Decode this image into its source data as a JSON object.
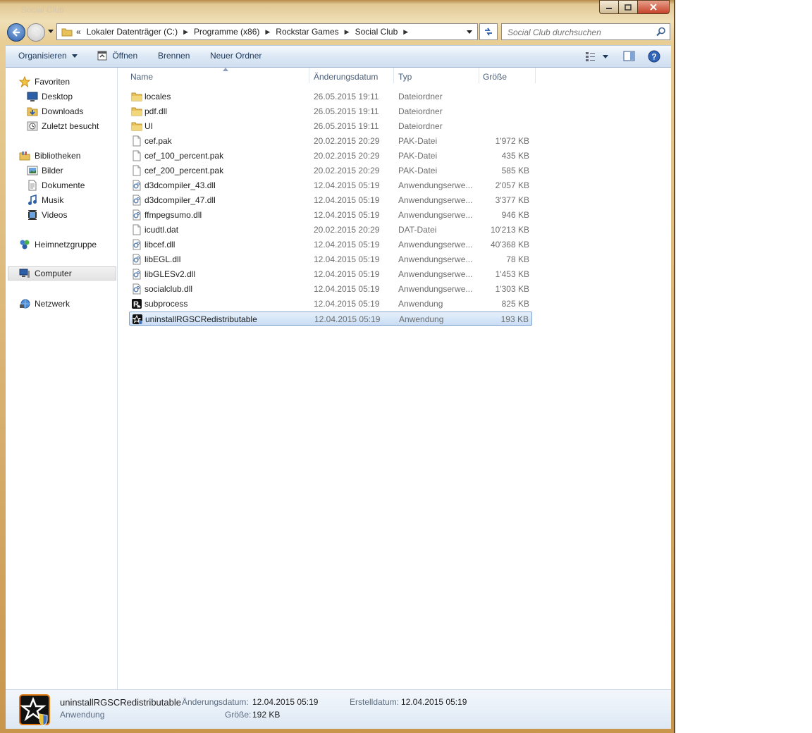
{
  "window": {
    "title": "Social Club",
    "colors": {
      "frame": "#e1c894",
      "toolbar": "#dce8f5",
      "selection": "#c8ddf5",
      "close": "#c7432b"
    }
  },
  "nav": {
    "address": {
      "overflow": "«",
      "breadcrumbs": [
        "Lokaler Datenträger (C:)",
        "Programme (x86)",
        "Rockstar Games",
        "Social Club"
      ]
    },
    "search_placeholder": "Social Club durchsuchen"
  },
  "toolbar": {
    "organize_label": "Organisieren",
    "open_label": "Öffnen",
    "burn_label": "Brennen",
    "new_folder_label": "Neuer Ordner"
  },
  "sidebar": {
    "favorites": {
      "label": "Favoriten",
      "items": [
        "Desktop",
        "Downloads",
        "Zuletzt besucht"
      ]
    },
    "libraries": {
      "label": "Bibliotheken",
      "items": [
        "Bilder",
        "Dokumente",
        "Musik",
        "Videos"
      ]
    },
    "homegroup": "Heimnetzgruppe",
    "computer": "Computer",
    "network": "Netzwerk"
  },
  "columns": {
    "name": "Name",
    "date": "Änderungsdatum",
    "type": "Typ",
    "size": "Größe"
  },
  "files": [
    {
      "name": "locales",
      "date": "26.05.2015 19:11",
      "type": "Dateiordner",
      "size": "",
      "icon": "folder-icon"
    },
    {
      "name": "pdf.dll",
      "date": "26.05.2015 19:11",
      "type": "Dateiordner",
      "size": "",
      "icon": "folder-icon"
    },
    {
      "name": "UI",
      "date": "26.05.2015 19:11",
      "type": "Dateiordner",
      "size": "",
      "icon": "folder-icon"
    },
    {
      "name": "cef.pak",
      "date": "20.02.2015 20:29",
      "type": "PAK-Datei",
      "size": "1'972 KB",
      "icon": "file-icon"
    },
    {
      "name": "cef_100_percent.pak",
      "date": "20.02.2015 20:29",
      "type": "PAK-Datei",
      "size": "435 KB",
      "icon": "file-icon"
    },
    {
      "name": "cef_200_percent.pak",
      "date": "20.02.2015 20:29",
      "type": "PAK-Datei",
      "size": "585 KB",
      "icon": "file-icon"
    },
    {
      "name": "d3dcompiler_43.dll",
      "date": "12.04.2015 05:19",
      "type": "Anwendungserwe...",
      "size": "2'057 KB",
      "icon": "dll-icon"
    },
    {
      "name": "d3dcompiler_47.dll",
      "date": "12.04.2015 05:19",
      "type": "Anwendungserwe...",
      "size": "3'377 KB",
      "icon": "dll-icon"
    },
    {
      "name": "ffmpegsumo.dll",
      "date": "12.04.2015 05:19",
      "type": "Anwendungserwe...",
      "size": "946 KB",
      "icon": "dll-icon"
    },
    {
      "name": "icudtl.dat",
      "date": "20.02.2015 20:29",
      "type": "DAT-Datei",
      "size": "10'213 KB",
      "icon": "file-icon"
    },
    {
      "name": "libcef.dll",
      "date": "12.04.2015 05:19",
      "type": "Anwendungserwe...",
      "size": "40'368 KB",
      "icon": "dll-icon"
    },
    {
      "name": "libEGL.dll",
      "date": "12.04.2015 05:19",
      "type": "Anwendungserwe...",
      "size": "78 KB",
      "icon": "dll-icon"
    },
    {
      "name": "libGLESv2.dll",
      "date": "12.04.2015 05:19",
      "type": "Anwendungserwe...",
      "size": "1'453 KB",
      "icon": "dll-icon"
    },
    {
      "name": "socialclub.dll",
      "date": "12.04.2015 05:19",
      "type": "Anwendungserwe...",
      "size": "1'303 KB",
      "icon": "dll-icon"
    },
    {
      "name": "subprocess",
      "date": "12.04.2015 05:19",
      "type": "Anwendung",
      "size": "825 KB",
      "icon": "rockstar-icon"
    },
    {
      "name": "uninstallRGSCRedistributable",
      "date": "12.04.2015 05:19",
      "type": "Anwendung",
      "size": "193 KB",
      "icon": "rockstar-star-icon",
      "selected": true
    }
  ],
  "details": {
    "name": "uninstallRGSCRedistributable",
    "type": "Anwendung",
    "modified_label": "Änderungsdatum:",
    "modified": "12.04.2015 05:19",
    "created_label": "Erstelldatum:",
    "created": "12.04.2015 05:19",
    "size_label": "Größe:",
    "size": "192 KB"
  }
}
